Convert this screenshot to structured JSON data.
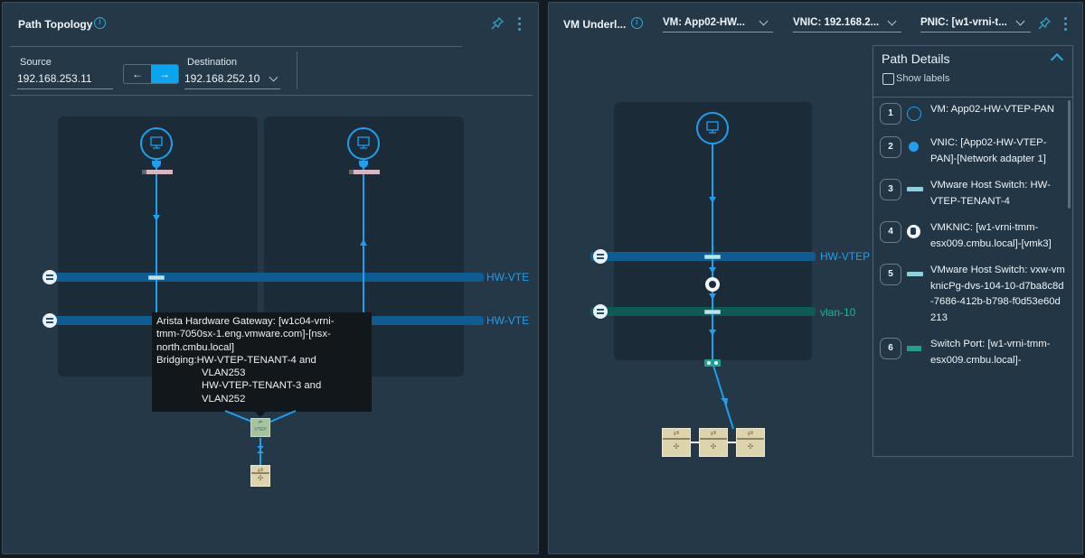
{
  "left_panel": {
    "title": "Path Topology",
    "source_label": "Source",
    "source_value": "192.168.253.11",
    "direction": {
      "left_arrow": "←",
      "right_arrow": "→",
      "selected": "right"
    },
    "destination_label": "Destination",
    "destination_value": "192.168.252.10",
    "bands": [
      {
        "label": "HW-VTE"
      },
      {
        "label": "HW-VTE"
      }
    ],
    "tooltip": {
      "line1": "Arista Hardware Gateway: [w1c04-vrni-",
      "line2": "tmm-7050sx-1.eng.vmware.com]-[nsx-",
      "line3": "north.cmbu.local]",
      "line4": "Bridging:HW-VTEP-TENANT-4 and",
      "line5": "VLAN253",
      "line6": "HW-VTEP-TENANT-3 and",
      "line7": "VLAN252"
    },
    "vtep_label": "VTEP"
  },
  "right_panel": {
    "title": "VM Underl...",
    "dropdowns": [
      {
        "value": "VM: App02-HW..."
      },
      {
        "value": "VNIC: 192.168.2..."
      },
      {
        "value": "PNIC: [w1-vrni-t..."
      }
    ],
    "bands": [
      {
        "label": "HW-VTEP",
        "color": "#1e9ff0"
      },
      {
        "label": "vlan-10",
        "color": "#1bb6a1"
      }
    ],
    "path_details": {
      "title": "Path Details",
      "show_labels": "Show labels",
      "show_labels_checked": false,
      "items": [
        {
          "num": "1",
          "icon": "vm-icon",
          "text": "VM: App02-HW-VTEP-PAN"
        },
        {
          "num": "2",
          "icon": "vnic-icon",
          "text": "VNIC: [App02-HW-VTEP-PAN]-[Network adapter 1]"
        },
        {
          "num": "3",
          "icon": "host-switch-icon",
          "text": "VMware Host Switch: HW-VTEP-TENANT-4"
        },
        {
          "num": "4",
          "icon": "vmknic-icon",
          "text": "VMKNIC: [w1-vrni-tmm-esx009.cmbu.local]-[vmk3]"
        },
        {
          "num": "5",
          "icon": "host-switch-icon",
          "text": "VMware Host Switch: vxw-vmknicPg-dvs-104-10-d7ba8c8d-7686-412b-b798-f0d53e60d213"
        },
        {
          "num": "6",
          "icon": "switch-port-icon",
          "text": "Switch Port: [w1-vrni-tmm-esx009.cmbu.local]-"
        }
      ]
    }
  }
}
